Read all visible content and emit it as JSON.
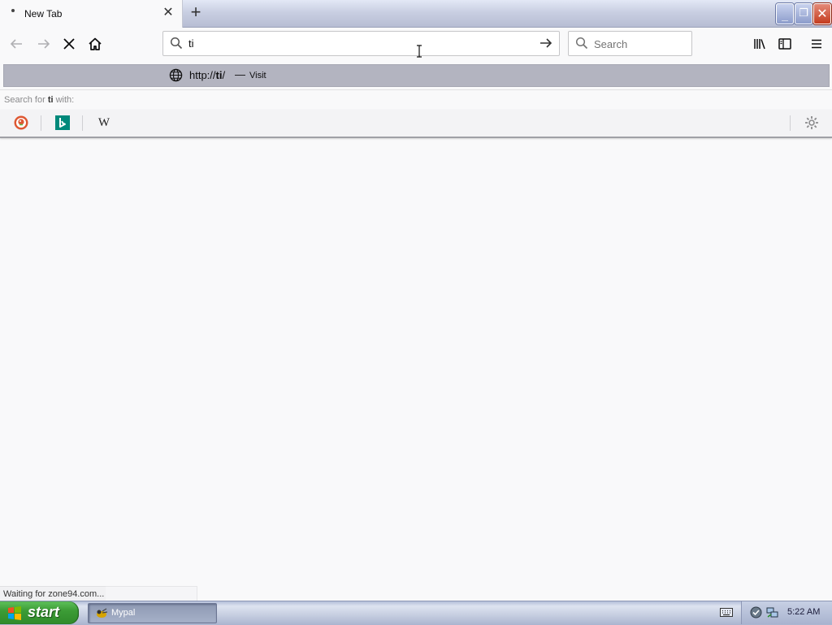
{
  "tab": {
    "title": "New Tab"
  },
  "urlbar": {
    "value": "ti"
  },
  "searchbar": {
    "placeholder": "Search"
  },
  "autocomplete": {
    "url_prefix": "http://",
    "url_bold": "ti",
    "url_suffix": "/",
    "dash": "—",
    "action": "Visit"
  },
  "search_for": {
    "prefix": "Search for ",
    "term": "ti",
    "suffix": " with:"
  },
  "engines": [
    "DuckDuckGo",
    "Bing",
    "Wikipedia"
  ],
  "engine_icons": {
    "wikipedia_glyph": "W"
  },
  "status": {
    "text": "Waiting for zone94.com..."
  },
  "taskbar": {
    "start_label": "start",
    "task_label": "Mypal",
    "clock": "5:22 AM"
  },
  "colors": {
    "start_green": "#3c9c36",
    "ac_highlight": "#b3b4c0",
    "close_red": "#c43c1e"
  }
}
